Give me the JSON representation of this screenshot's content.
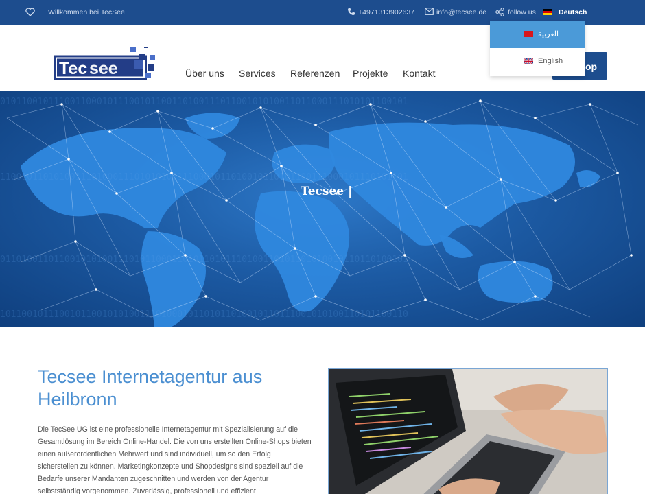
{
  "topbar": {
    "welcome": "Willkommen bei TecSee",
    "phone": "+4971313902637",
    "email": "info@tecsee.de",
    "follow": "follow us",
    "language": "Deutsch"
  },
  "language_menu": {
    "items": [
      {
        "label": "العربية",
        "flag": "arabic-flag"
      },
      {
        "label": "English",
        "flag": "uk-flag"
      }
    ]
  },
  "header": {
    "logo_text": "Tecsee",
    "nav": [
      "Über uns",
      "Services",
      "Referenzen",
      "Projekte",
      "Kontakt"
    ],
    "shop_label": "op"
  },
  "hero": {
    "title": "Tecsee |"
  },
  "content": {
    "headline": "Tecsee Internetagentur aus Heilbronn",
    "paragraph": "Die TecSee UG ist eine professionelle Internetagentur mit Spezialisierung auf die Gesamtlösung im Bereich Online-Handel. Die von uns erstellten Online-Shops bieten einen außerordentlichen Mehrwert und sind individuell, um so den Erfolg sicherstellen zu können. Marketingkonzepte und Shopdesigns sind speziell auf die Bedarfe unserer Mandanten zugeschnitten und werden von der Agentur selbstständig vorgenommen. Zuverlässig, professionell und effizient"
  },
  "colors": {
    "primary": "#1d4d8e",
    "accent": "#4b8fd1",
    "dropdown_active": "#4b9ad8"
  }
}
